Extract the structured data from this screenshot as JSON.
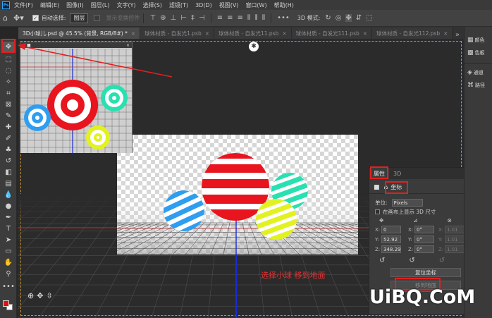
{
  "menubar": {
    "logo": "Ps",
    "items": [
      "文件(F)",
      "编辑(E)",
      "图像(I)",
      "图层(L)",
      "文字(Y)",
      "选择(S)",
      "滤镜(T)",
      "3D(D)",
      "视图(V)",
      "窗口(W)",
      "帮助(H)"
    ]
  },
  "options": {
    "auto_select_label": "自动选择:",
    "auto_select_value": "图层",
    "show_transform_label": "显示变换控件",
    "more_label": "•••",
    "mode_label": "3D 模式:"
  },
  "tabs": [
    {
      "label": "3D小球儿.psd @ 45.5% (背景, RGB/8#) *",
      "active": true
    },
    {
      "label": "球体材质 - 自发光1.psb",
      "active": false
    },
    {
      "label": "球体材质 - 自发光11.psb",
      "active": false
    },
    {
      "label": "球体材质 - 自发光111.psb",
      "active": false
    },
    {
      "label": "球体材质 - 自发光112.psb",
      "active": false
    }
  ],
  "annotation": "选择小球 移到地面",
  "properties": {
    "tab_properties": "属性",
    "tab_3d": "3D",
    "coord_label": "坐标",
    "unit_label": "单位:",
    "unit_value": "Pixels",
    "show_on_canvas_label": "在画布上显示 3D 尺寸",
    "rows": [
      {
        "axis": "X:",
        "pos": "0",
        "rot": "0°",
        "scale_axis": "X:",
        "scale": "1.01"
      },
      {
        "axis": "Y:",
        "pos": "52.92",
        "rot": "0°",
        "scale_axis": "Y:",
        "scale": "1.01"
      },
      {
        "axis": "Z:",
        "pos": "348.29",
        "rot": "0°",
        "scale_axis": "Z:",
        "scale": "1.01"
      }
    ],
    "reset_coords": "复位坐标",
    "move_to_ground": "移到地面"
  },
  "dock": [
    {
      "icon": "paths-icon",
      "label": "颜色"
    },
    {
      "icon": "swatches-icon",
      "label": "色板"
    },
    {
      "icon": "channels-icon",
      "label": "通道"
    },
    {
      "icon": "path-icon",
      "label": "路径"
    }
  ],
  "watermark": "UiBQ.CoM",
  "colors": {
    "accent_red": "#e02020",
    "ball_red": "#e8141e",
    "ball_blue": "#2f9df0",
    "ball_mint": "#29e0b0",
    "ball_yellow": "#e2f220"
  }
}
